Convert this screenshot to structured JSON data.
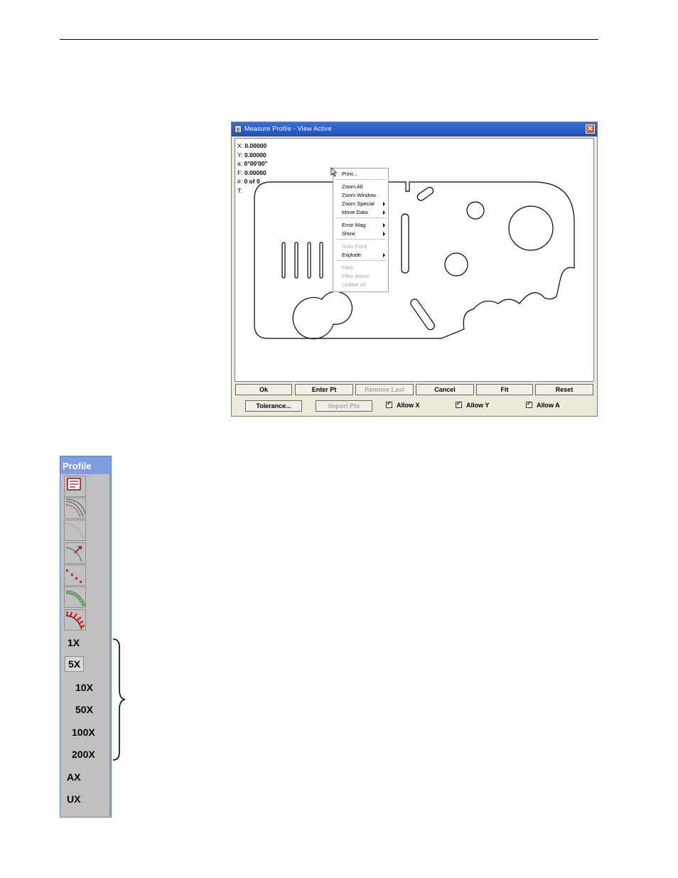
{
  "window": {
    "title": "Measure Profile - View Active",
    "close_label": "✕"
  },
  "readout": [
    {
      "label": "X:",
      "value": "0.00000"
    },
    {
      "label": "Y:",
      "value": "0.00000"
    },
    {
      "label": "a:",
      "value": "0°00'00\""
    },
    {
      "label": "F:",
      "value": "0.00000"
    },
    {
      "label": "#:",
      "value": "0 of 0"
    },
    {
      "label": "T:",
      "value": ""
    }
  ],
  "context_menu": {
    "items": [
      {
        "label": "Print...",
        "enabled": true,
        "submenu": false
      },
      {
        "label": "Zoom All",
        "enabled": true,
        "submenu": false
      },
      {
        "label": "Zoom Window",
        "enabled": true,
        "submenu": false
      },
      {
        "label": "Zoom Special",
        "enabled": true,
        "submenu": true
      },
      {
        "label": "Move Data",
        "enabled": true,
        "submenu": true
      },
      {
        "label": "Error Mag",
        "enabled": true,
        "submenu": true
      },
      {
        "label": "Show",
        "enabled": true,
        "submenu": true
      },
      {
        "label": "Goto Point",
        "enabled": false,
        "submenu": false
      },
      {
        "label": "Explode",
        "enabled": true,
        "submenu": true
      },
      {
        "label": "Filter",
        "enabled": false,
        "submenu": false
      },
      {
        "label": "Filter Worst",
        "enabled": false,
        "submenu": false
      },
      {
        "label": "Unfilter All",
        "enabled": false,
        "submenu": false
      }
    ]
  },
  "buttons_row1": [
    {
      "label": "Ok",
      "enabled": true
    },
    {
      "label": "Enter Pt",
      "enabled": true
    },
    {
      "label": "Remove Last",
      "enabled": false
    },
    {
      "label": "Cancel",
      "enabled": true
    },
    {
      "label": "Fit",
      "enabled": true
    },
    {
      "label": "Reset",
      "enabled": true
    }
  ],
  "buttons_row2": [
    {
      "label": "Tolerance...",
      "enabled": true
    },
    {
      "label": "Import Pts",
      "enabled": false
    }
  ],
  "checkboxes": [
    {
      "label": "Allow X",
      "checked": true
    },
    {
      "label": "Allow Y",
      "checked": true
    },
    {
      "label": "Allow A",
      "checked": true
    }
  ],
  "toolbar": {
    "title": "Profile",
    "icon_buttons": [
      "report-icon",
      "profile-tolerance-icon",
      "profile-points-icon",
      "profile-vector-icon",
      "profile-crosses-icon",
      "profile-green-band-icon",
      "profile-red-whiskers-icon"
    ],
    "zoom_items": [
      "1X",
      "5X",
      "10X",
      "50X",
      "100X",
      "200X",
      "AX",
      "UX"
    ],
    "pressed_zoom": "5X"
  },
  "colors": {
    "titlebar": "#2a5fcf",
    "toolbar_title": "#7f9ee0",
    "dialog_bg": "#ece9d8",
    "icon_red": "#8b1010",
    "icon_green": "#2aa82a"
  }
}
